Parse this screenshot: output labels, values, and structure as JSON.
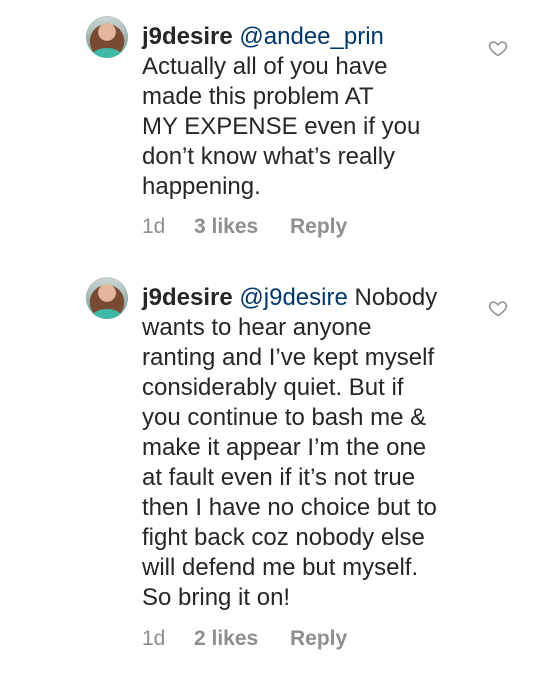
{
  "comments": [
    {
      "username": "j9desire",
      "mention": "@andee_prin",
      "text_lines": [
        "Actually all of you have",
        "made this problem AT",
        "MY EXPENSE even if you",
        "don’t know what’s really",
        "happening."
      ],
      "time": "1d",
      "likes": "3 likes",
      "reply_label": "Reply",
      "icons": {
        "avatar": "profile-photo",
        "like": "heart-outline-icon"
      }
    },
    {
      "username": "j9desire",
      "mention": "@j9desire",
      "first_line_tail": "Nobody",
      "text_lines": [
        "wants to hear anyone",
        "ranting and I’ve kept myself",
        "considerably quiet. But if",
        "you continue to bash me &",
        "make it appear I’m the one",
        "at fault even if it’s not true",
        "then I have no choice but to",
        "fight back coz nobody else",
        "will defend me but myself.",
        "So bring it on!"
      ],
      "time": "1d",
      "likes": "2 likes",
      "reply_label": "Reply",
      "icons": {
        "avatar": "profile-photo",
        "like": "heart-outline-icon"
      }
    }
  ],
  "colors": {
    "text": "#262626",
    "muted": "#8e8e8e",
    "mention": "#00376b"
  }
}
